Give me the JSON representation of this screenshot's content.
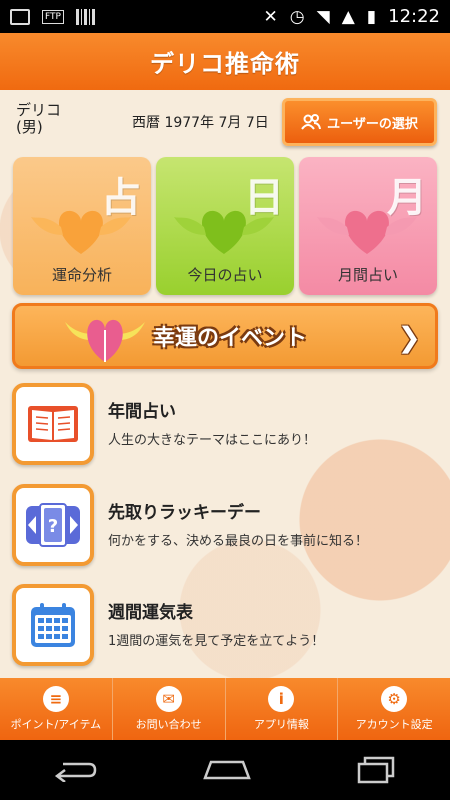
{
  "status": {
    "time": "12:22"
  },
  "app": {
    "title": "デリコ推命術"
  },
  "user": {
    "name": "デリコ",
    "gender": "(男)",
    "birth": "西暦 1977年 7月 7日",
    "select_button": "ユーザーの選択"
  },
  "tiles": [
    {
      "kanji": "占",
      "label": "運命分析"
    },
    {
      "kanji": "日",
      "label": "今日の占い"
    },
    {
      "kanji": "月",
      "label": "月間占い"
    }
  ],
  "event": {
    "title": "幸運のイベント"
  },
  "menu": [
    {
      "title": "年間占い",
      "subtitle": "人生の大きなテーマはここにあり！"
    },
    {
      "title": "先取りラッキーデー",
      "subtitle": "何かをする、決める最良の日を事前に知る！"
    },
    {
      "title": "週間運気表",
      "subtitle": "1週間の運気を見て予定を立てよう！"
    }
  ],
  "tabs": [
    {
      "label": "ポイント/アイテム",
      "icon": "coins-icon"
    },
    {
      "label": "お問い合わせ",
      "icon": "mail-icon"
    },
    {
      "label": "アプリ情報",
      "icon": "info-icon"
    },
    {
      "label": "アカウント設定",
      "icon": "gear-icon"
    }
  ],
  "colors": {
    "accent": "#f07a1c",
    "green": "#99d02e",
    "pink": "#f48aa4"
  }
}
